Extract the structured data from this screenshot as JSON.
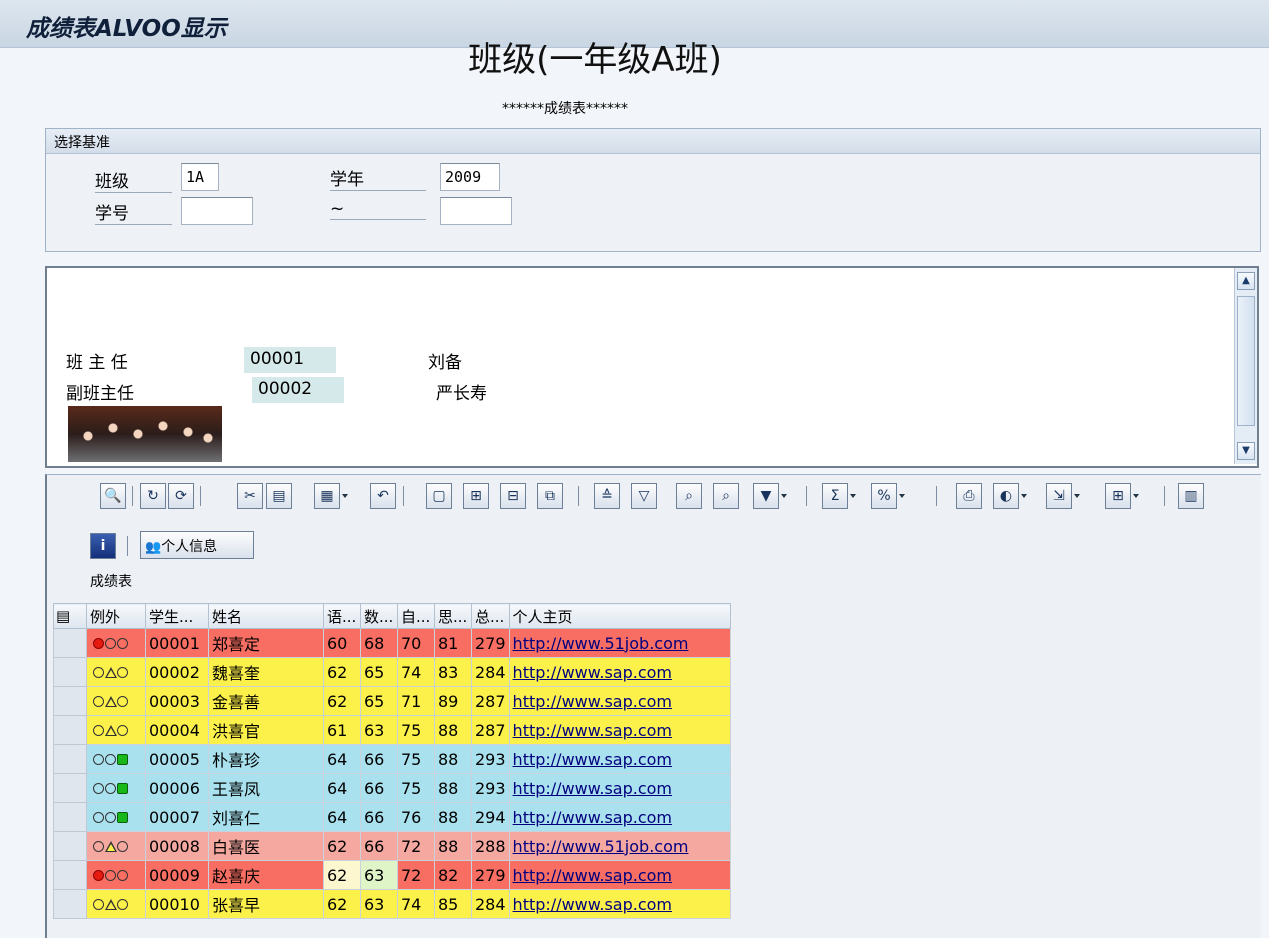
{
  "app": {
    "title": "成绩表ALVOO显示"
  },
  "report": {
    "heading": "******成绩表******"
  },
  "selection": {
    "frame_title": "选择基准",
    "class_label": "班级",
    "class_value": "1A",
    "year_label": "学年",
    "year_value": "2009",
    "student_no_label": "学号",
    "student_no_from": "",
    "range_sep": "~",
    "student_no_to": ""
  },
  "header_panel": {
    "class_title": "班级(一年级A班)",
    "teacher_label": "班 主 任",
    "teacher_id": "00001",
    "teacher_name": "刘备",
    "deputy_label": "副班主任",
    "deputy_id": "00002",
    "deputy_name": "严长寿",
    "scroll_up_icon": "arrow-up-icon",
    "scroll_down_icon": "arrow-down-icon"
  },
  "toolbar": {
    "icons": [
      "details-icon",
      "refresh-icon",
      "refresh-cycle-icon",
      "cut-icon",
      "copy-icon",
      "paste-icon",
      "undo-icon",
      "new-row-icon",
      "insert-row-icon",
      "delete-row-icon",
      "copy-row-icon",
      "sort-ascending-icon",
      "sort-descending-icon",
      "find-icon",
      "find-next-icon",
      "filter-icon",
      "sum-icon",
      "subtotal-icon",
      "print-icon",
      "views-icon",
      "export-icon",
      "layout-icon",
      "graphic-icon",
      "info-icon"
    ],
    "personal_info_label": "个人信息"
  },
  "grid": {
    "title": "成绩表",
    "columns": [
      "例外",
      "学生...",
      "姓名",
      "语...",
      "数...",
      "自...",
      "思...",
      "总...",
      "个人主页"
    ],
    "rows": [
      {
        "light": "red",
        "id": "00001",
        "name": "郑喜定",
        "c1": "60",
        "c2": "68",
        "c3": "70",
        "c4": "81",
        "total": "279",
        "url": "http://www.51job.com",
        "color": "red"
      },
      {
        "light": "yellow",
        "id": "00002",
        "name": "魏喜奎",
        "c1": "62",
        "c2": "65",
        "c3": "74",
        "c4": "83",
        "total": "284",
        "url": "http://www.sap.com",
        "color": "yellow"
      },
      {
        "light": "yellow",
        "id": "00003",
        "name": "金喜善",
        "c1": "62",
        "c2": "65",
        "c3": "71",
        "c4": "89",
        "total": "287",
        "url": "http://www.sap.com",
        "color": "yellow"
      },
      {
        "light": "yellow",
        "id": "00004",
        "name": "洪喜官",
        "c1": "61",
        "c2": "63",
        "c3": "75",
        "c4": "88",
        "total": "287",
        "url": "http://www.sap.com",
        "color": "yellow"
      },
      {
        "light": "green",
        "id": "00005",
        "name": "朴喜珍",
        "c1": "64",
        "c2": "66",
        "c3": "75",
        "c4": "88",
        "total": "293",
        "url": "http://www.sap.com",
        "color": "blue"
      },
      {
        "light": "green",
        "id": "00006",
        "name": "王喜凤",
        "c1": "64",
        "c2": "66",
        "c3": "75",
        "c4": "88",
        "total": "293",
        "url": "http://www.sap.com",
        "color": "blue"
      },
      {
        "light": "green",
        "id": "00007",
        "name": "刘喜仁",
        "c1": "64",
        "c2": "66",
        "c3": "76",
        "c4": "88",
        "total": "294",
        "url": "http://www.sap.com",
        "color": "blue"
      },
      {
        "light": "yellow",
        "id": "00008",
        "name": "白喜医",
        "c1": "62",
        "c2": "66",
        "c3": "72",
        "c4": "88",
        "total": "288",
        "url": "http://www.51job.com",
        "color": "pink"
      },
      {
        "light": "red",
        "id": "00009",
        "name": "赵喜庆",
        "c1": "62",
        "c2": "63",
        "c3": "72",
        "c4": "82",
        "total": "279",
        "url": "http://www.sap.com",
        "color": "red",
        "cell_colors": {
          "c1": "#fdf7cf",
          "c2": "#dff5c8"
        }
      },
      {
        "light": "yellow",
        "id": "00010",
        "name": "张喜早",
        "c1": "62",
        "c2": "63",
        "c3": "74",
        "c4": "85",
        "total": "284",
        "url": "http://www.sap.com",
        "color": "yellow"
      }
    ]
  },
  "colors": {
    "red": "#f86e62",
    "yellow": "#fcf14a",
    "blue": "#a9e2ee",
    "pink": "#f4a8a0"
  }
}
